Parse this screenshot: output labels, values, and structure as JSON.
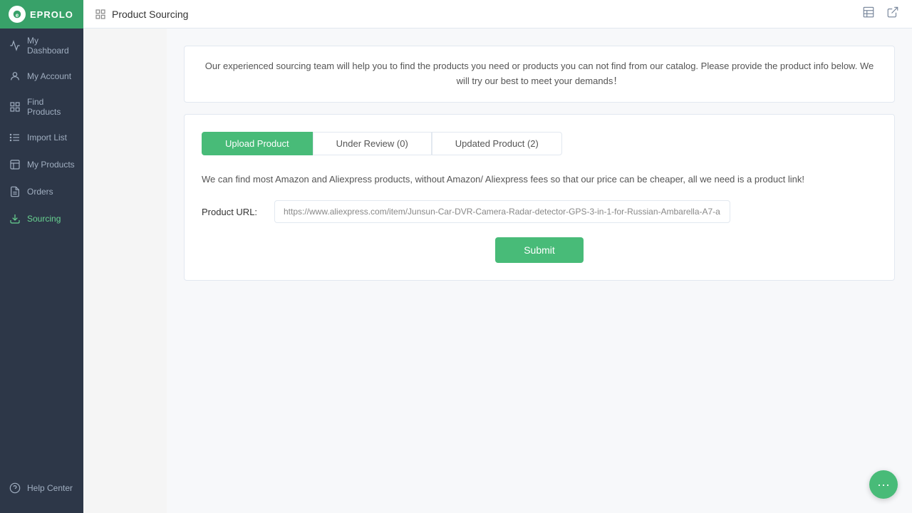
{
  "app": {
    "logo_text": "EPROLO"
  },
  "sidebar": {
    "items": [
      {
        "id": "dashboard",
        "label": "My Dashboard",
        "icon": "chart-line"
      },
      {
        "id": "account",
        "label": "My Account",
        "icon": "user"
      },
      {
        "id": "find-products",
        "label": "Find Products",
        "icon": "grid"
      },
      {
        "id": "import-list",
        "label": "Import List",
        "icon": "list"
      },
      {
        "id": "my-products",
        "label": "My Products",
        "icon": "box"
      },
      {
        "id": "orders",
        "label": "Orders",
        "icon": "file-text"
      },
      {
        "id": "sourcing",
        "label": "Sourcing",
        "icon": "download",
        "active": true
      }
    ],
    "bottom": {
      "help_label": "Help Center"
    }
  },
  "topbar": {
    "page_title": "Product Sourcing",
    "icon1": "grid-icon",
    "icon2": "external-link-icon"
  },
  "info_banner": {
    "text": "Our experienced sourcing team will help you to find the products you need or products you can not find from our catalog. Please provide the product info below. We will try our best to meet your demands！"
  },
  "tabs": [
    {
      "id": "upload",
      "label": "Upload Product",
      "active": true
    },
    {
      "id": "review",
      "label": "Under Review (0)",
      "active": false
    },
    {
      "id": "updated",
      "label": "Updated Product (2)",
      "active": false
    }
  ],
  "upload_section": {
    "hint": "We can find most Amazon and Aliexpress products, without Amazon/ Aliexpress fees so that our price can be cheaper, all we need is a product link!",
    "form": {
      "label": "Product URL:",
      "input_value": "https://www.aliexpress.com/item/Junsun-Car-DVR-Camera-Radar-detector-GPS-3-in-1-for-Russian-Ambarella-A7-a...",
      "submit_label": "Submit"
    }
  }
}
